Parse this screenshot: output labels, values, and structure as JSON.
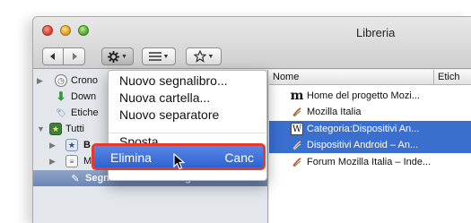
{
  "window": {
    "title": "Libreria"
  },
  "toolbar": {
    "back_icon": "back-arrow-icon",
    "forward_icon": "forward-arrow-icon",
    "organize_icon": "gear-icon",
    "views_icon": "list-icon",
    "import_icon": "star-import-icon"
  },
  "sidebar": {
    "items": [
      {
        "label": "Crono",
        "icon": "history-clock-icon"
      },
      {
        "label": "Down",
        "icon": "download-arrow-icon"
      },
      {
        "label": "Etiche",
        "icon": "tag-icon"
      },
      {
        "label": "Tutti",
        "icon": "star-folder-icon"
      },
      {
        "label": "B",
        "icon": "bookmarks-toolbar-icon"
      },
      {
        "label": "M",
        "icon": "bookmarks-menu-icon"
      },
      {
        "label": "Segnalibri non catalogati",
        "icon": "unsorted-bookmarks-icon"
      }
    ]
  },
  "columns": {
    "name": "Nome",
    "tags": "Etich"
  },
  "rows": [
    {
      "label": "Home del progetto Mozi...",
      "icon": "mozilla-m-icon",
      "selected": false
    },
    {
      "label": "Mozilla Italia",
      "icon": "mozilla-italia-icon",
      "selected": false
    },
    {
      "label": "Categoria:Dispositivi An...",
      "icon": "wikipedia-w-icon",
      "selected": true
    },
    {
      "label": "Dispositivi Android – An...",
      "icon": "mozilla-italia-icon",
      "selected": true
    },
    {
      "label": "Forum Mozilla Italia – Inde...",
      "icon": "mozilla-italia-icon",
      "selected": false
    }
  ],
  "menu": {
    "items": [
      {
        "label": "Nuovo segnalibro..."
      },
      {
        "label": "Nuova cartella..."
      },
      {
        "label": "Nuovo separatore"
      },
      {
        "label": "Sposta"
      }
    ],
    "highlighted": {
      "label": "Elimina",
      "shortcut": "Canc"
    }
  },
  "colors": {
    "selection": "#3a6fd0",
    "highlight_border": "#e43b2c"
  }
}
